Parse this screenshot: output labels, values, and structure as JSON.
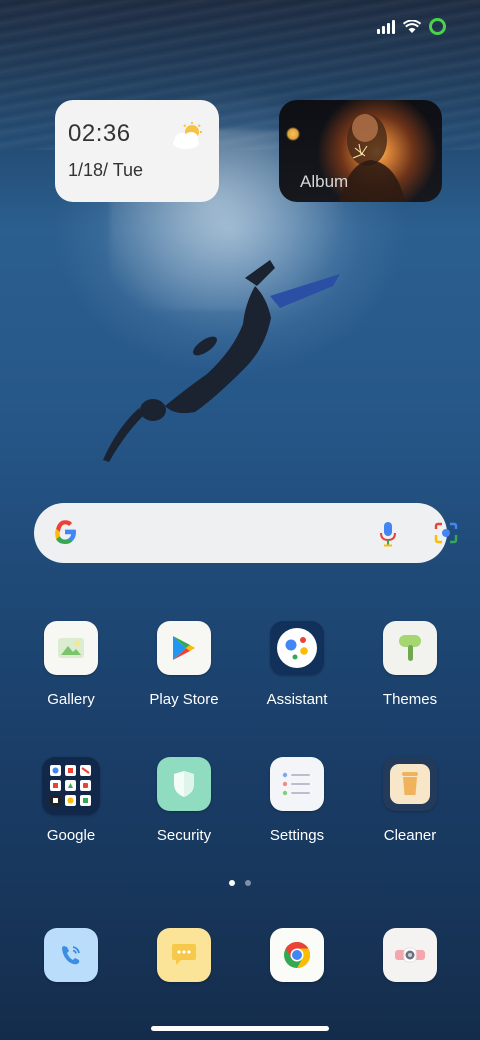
{
  "status_bar": {
    "signal_icon": "cellular-signal-icon",
    "wifi_icon": "wifi-icon",
    "battery_icon": "battery-ring-icon",
    "accent": "#49d24a"
  },
  "clock_widget": {
    "time": "02:36",
    "date": "1/18/ Tue",
    "weather_icon": "partly-cloudy-icon"
  },
  "album_widget": {
    "label": "Album"
  },
  "search_bar": {
    "logo_icon": "google-g-icon",
    "voice_icon": "microphone-icon",
    "lens_icon": "camera-lens-icon"
  },
  "apps": [
    {
      "label": "Gallery",
      "icon": "gallery-icon"
    },
    {
      "label": "Play Store",
      "icon": "play-store-icon"
    },
    {
      "label": "Assistant",
      "icon": "assistant-icon"
    },
    {
      "label": "Themes",
      "icon": "themes-icon"
    },
    {
      "label": "Google",
      "icon": "google-folder-icon"
    },
    {
      "label": "Security",
      "icon": "security-shield-icon"
    },
    {
      "label": "Settings",
      "icon": "settings-icon"
    },
    {
      "label": "Cleaner",
      "icon": "cleaner-trash-icon"
    }
  ],
  "page_indicator": {
    "pages": 2,
    "current": 1
  },
  "dock": [
    {
      "icon": "phone-icon"
    },
    {
      "icon": "messages-icon"
    },
    {
      "icon": "chrome-icon"
    },
    {
      "icon": "camera-icon"
    }
  ]
}
